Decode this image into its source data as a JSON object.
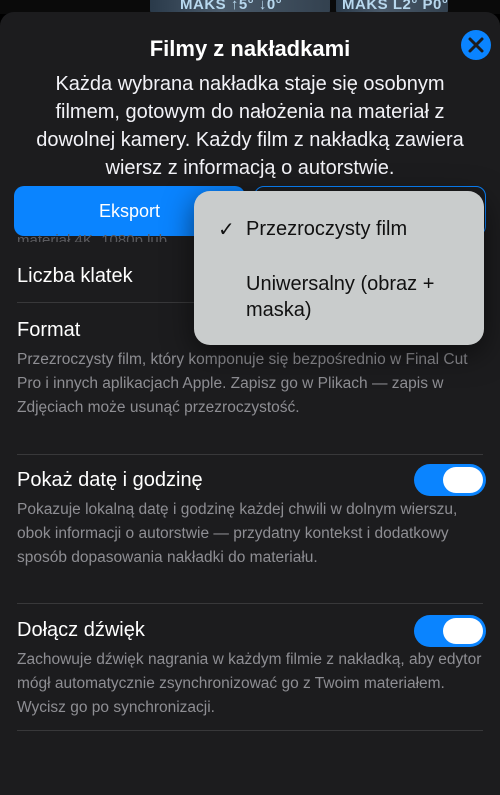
{
  "background": {
    "left_label": "MAKS ↑5° ↓0°",
    "right_label": "MAKS L2° P0°"
  },
  "sheet": {
    "title": "Filmy z nakładkami",
    "description": "Każda wybrana nakładka staje się osobnym filmem, gotowym do nałożenia na materiał z dowolnej kamery. Każdy film z nakładką zawiera wiersz z informacją o autorstwie.",
    "close_icon": "close-icon"
  },
  "buttons": {
    "export_label": "Eksport"
  },
  "faded_text": "materiał 4K, 1080p lub",
  "rows": {
    "frames_label": "Liczba klatek",
    "format_label": "Format",
    "format_desc": "Przezroczysty film, który komponuje się bezpośrednio w Final Cut Pro i innych aplikacjach Apple. Zapisz go w Plikach — zapis w Zdjęciach może usunąć przezroczystość.",
    "datetime_label": "Pokaż datę i godzinę",
    "datetime_desc": "Pokazuje lokalną datę i godzinę każdej chwili w dolnym wierszu, obok informacji o autorstwie — przydatny kontekst i dodatkowy sposób dopasowania nakładki do materiału.",
    "audio_label": "Dołącz dźwięk",
    "audio_desc": "Zachowuje dźwięk nagrania w każdym filmie z nakładką, aby edytor mógł automatycznie zsynchronizować go z Twoim materiałem. Wycisz go po synchronizacji."
  },
  "popup_menu": {
    "selected_check": "✓",
    "options": [
      {
        "label": "Przezroczysty film",
        "selected": true
      },
      {
        "label": "Uniwersalny (obraz + maska)",
        "selected": false
      }
    ]
  },
  "toggles": {
    "datetime_on": true,
    "audio_on": true
  },
  "colors": {
    "accent": "#0a84ff",
    "sheet_bg": "#1c1c1e",
    "popup_bg": "#c9cccc"
  }
}
